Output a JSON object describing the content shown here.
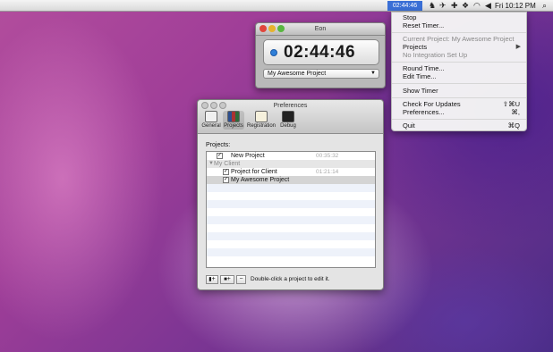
{
  "menubar": {
    "timer": "02:44:46",
    "status_icons": [
      "adium-icon",
      "bird-icon",
      "plus-icon",
      "dropbox-icon",
      "wifi-icon",
      "volume-icon"
    ],
    "clock": "Fri 10:12 PM"
  },
  "menu": {
    "stop": "Stop",
    "reset": "Reset Timer...",
    "current_project": "Current Project: My Awesome Project",
    "projects": "Projects",
    "integration": "No Integration Set Up",
    "round_time": "Round Time...",
    "edit_time": "Edit Time...",
    "show_timer": "Show Timer",
    "check_updates": "Check For Updates",
    "check_updates_shortcut": "⇧⌘U",
    "preferences": "Preferences...",
    "preferences_shortcut": "⌘,",
    "quit": "Quit",
    "quit_shortcut": "⌘Q"
  },
  "eon": {
    "title": "Eon",
    "time": "02:44:46",
    "selected_project": "My Awesome Project"
  },
  "prefs": {
    "title": "Preferences",
    "tabs": [
      "General",
      "Projects",
      "Registration",
      "Debug"
    ],
    "projects_label": "Projects:",
    "rows": [
      {
        "name": "New Project",
        "time": "00:35:32",
        "checked": true
      },
      {
        "name": "My Client",
        "group": true
      },
      {
        "name": "Project for Client",
        "time": "01:21:14",
        "checked": true
      },
      {
        "name": "My Awesome Project",
        "time": "",
        "checked": true
      }
    ],
    "hint": "Double-click a project to edit it.",
    "add_label": "+",
    "remove_label": "−"
  },
  "colors": {
    "accent": "#3a6fd6"
  }
}
